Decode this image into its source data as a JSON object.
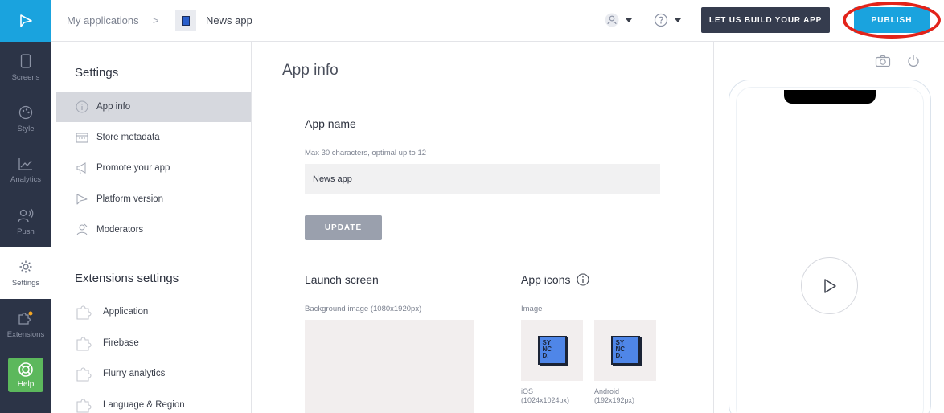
{
  "rail": {
    "items": [
      {
        "label": "Screens",
        "icon": "phone-icon"
      },
      {
        "label": "Style",
        "icon": "palette-icon"
      },
      {
        "label": "Analytics",
        "icon": "chart-icon"
      },
      {
        "label": "Push",
        "icon": "push-icon"
      },
      {
        "label": "Settings",
        "icon": "gear-icon"
      },
      {
        "label": "Extensions",
        "icon": "puzzle-icon"
      }
    ],
    "help_label": "Help"
  },
  "header": {
    "breadcrumb_root": "My applications",
    "breadcrumb_sep": ">",
    "app_name": "News app",
    "build_button": "LET US BUILD YOUR APP",
    "publish_button": "PUBLISH"
  },
  "settings_nav": {
    "heading": "Settings",
    "items": [
      {
        "label": "App info",
        "active": true
      },
      {
        "label": "Store metadata"
      },
      {
        "label": "Promote your app"
      },
      {
        "label": "Platform version"
      },
      {
        "label": "Moderators"
      }
    ],
    "extensions_heading": "Extensions settings",
    "extensions": [
      {
        "label": "Application"
      },
      {
        "label": "Firebase"
      },
      {
        "label": "Flurry analytics"
      },
      {
        "label": "Language & Region"
      }
    ]
  },
  "main": {
    "title": "App info",
    "app_name_section": {
      "title": "App name",
      "hint": "Max 30 characters, optimal up to 12",
      "value": "News app",
      "update_button": "UPDATE"
    },
    "launch_screen": {
      "title": "Launch screen",
      "hint": "Background image (1080x1920px)"
    },
    "app_icons": {
      "title": "App icons",
      "hint": "Image",
      "ios_label": "iOS",
      "ios_size": "(1024x1024px)",
      "android_label": "Android",
      "android_size": "(192x192px)",
      "logo_text": [
        "SY",
        "NC",
        "D."
      ]
    }
  },
  "colors": {
    "rail_bg": "#2c3447",
    "accent": "#1aa3de",
    "help_green": "#5cb85c",
    "highlight_ring": "#e2231a"
  }
}
